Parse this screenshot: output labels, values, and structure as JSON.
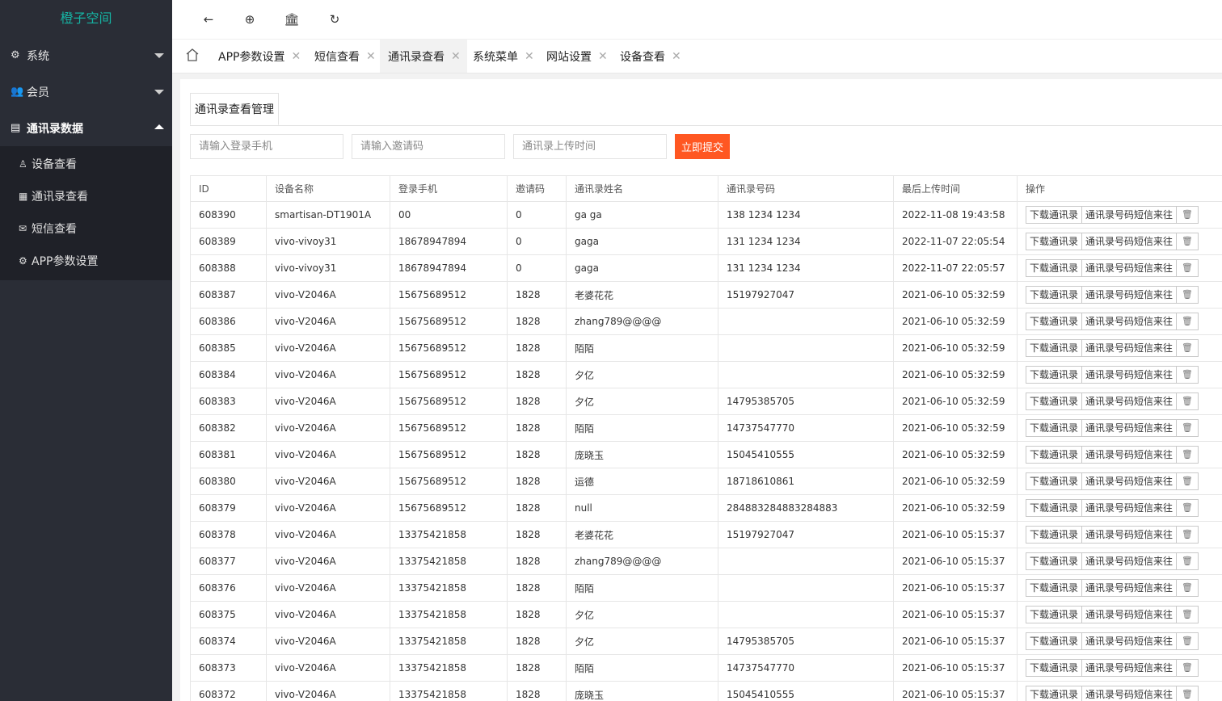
{
  "sidebar": {
    "logo": "橙子空间",
    "groups": [
      {
        "icon": "gear-icon",
        "label": "系统",
        "expanded": false
      },
      {
        "icon": "users-icon",
        "label": "会员",
        "expanded": false
      },
      {
        "icon": "card-icon",
        "label": "通讯录数据",
        "expanded": true
      }
    ],
    "items": [
      {
        "icon": "user-icon",
        "label": "设备查看"
      },
      {
        "icon": "building-icon",
        "label": "通讯录查看"
      },
      {
        "icon": "envelope-icon",
        "label": "短信查看"
      },
      {
        "icon": "gear-icon",
        "label": "APP参数设置"
      }
    ]
  },
  "toolbar": {
    "back_icon": "←",
    "globe_icon": "⊕",
    "bank_icon": "🏛",
    "refresh_icon": "↻"
  },
  "tabs": [
    {
      "label": "APP参数设置"
    },
    {
      "label": "短信查看"
    },
    {
      "label": "通讯录查看",
      "active": true
    },
    {
      "label": "系统菜单"
    },
    {
      "label": "网站设置"
    },
    {
      "label": "设备查看"
    }
  ],
  "tab_close": "✕",
  "panel": {
    "title": "通讯录查看管理"
  },
  "search": {
    "phone_placeholder": "请输入登录手机",
    "invite_placeholder": "请输入邀请码",
    "time_placeholder": "通讯录上传时间",
    "submit": "立即提交"
  },
  "table": {
    "headers": [
      "ID",
      "设备名称",
      "登录手机",
      "邀请码",
      "通讯录姓名",
      "通讯录号码",
      "最后上传时间",
      "操作"
    ],
    "actions": [
      "下载通讯录",
      "通讯录号码短信来往",
      "🗑"
    ],
    "rows": [
      [
        "608390",
        "smartisan-DT1901A",
        "00",
        "0",
        "ga ga",
        "138 1234 1234",
        "2022-11-08 19:43:58"
      ],
      [
        "608389",
        "vivo-vivoy31",
        "18678947894",
        "0",
        "gaga",
        "131 1234 1234",
        "2022-11-07 22:05:54"
      ],
      [
        "608388",
        "vivo-vivoy31",
        "18678947894",
        "0",
        "gaga",
        "131 1234 1234",
        "2022-11-07 22:05:57"
      ],
      [
        "608387",
        "vivo-V2046A",
        "15675689512",
        "1828",
        "老婆花花",
        "15197927047",
        "2021-06-10 05:32:59"
      ],
      [
        "608386",
        "vivo-V2046A",
        "15675689512",
        "1828",
        "zhang789@@@@",
        "",
        "2021-06-10 05:32:59"
      ],
      [
        "608385",
        "vivo-V2046A",
        "15675689512",
        "1828",
        "陌陌",
        "",
        "2021-06-10 05:32:59"
      ],
      [
        "608384",
        "vivo-V2046A",
        "15675689512",
        "1828",
        "夕亿",
        "",
        "2021-06-10 05:32:59"
      ],
      [
        "608383",
        "vivo-V2046A",
        "15675689512",
        "1828",
        "夕亿",
        "14795385705",
        "2021-06-10 05:32:59"
      ],
      [
        "608382",
        "vivo-V2046A",
        "15675689512",
        "1828",
        "陌陌",
        "14737547770",
        "2021-06-10 05:32:59"
      ],
      [
        "608381",
        "vivo-V2046A",
        "15675689512",
        "1828",
        "庞晓玉",
        "15045410555",
        "2021-06-10 05:32:59"
      ],
      [
        "608380",
        "vivo-V2046A",
        "15675689512",
        "1828",
        "运德",
        "18718610861",
        "2021-06-10 05:32:59"
      ],
      [
        "608379",
        "vivo-V2046A",
        "15675689512",
        "1828",
        "null",
        "284883284883284883",
        "2021-06-10 05:32:59"
      ],
      [
        "608378",
        "vivo-V2046A",
        "13375421858",
        "1828",
        "老婆花花",
        "15197927047",
        "2021-06-10 05:15:37"
      ],
      [
        "608377",
        "vivo-V2046A",
        "13375421858",
        "1828",
        "zhang789@@@@",
        "",
        "2021-06-10 05:15:37"
      ],
      [
        "608376",
        "vivo-V2046A",
        "13375421858",
        "1828",
        "陌陌",
        "",
        "2021-06-10 05:15:37"
      ],
      [
        "608375",
        "vivo-V2046A",
        "13375421858",
        "1828",
        "夕亿",
        "",
        "2021-06-10 05:15:37"
      ],
      [
        "608374",
        "vivo-V2046A",
        "13375421858",
        "1828",
        "夕亿",
        "14795385705",
        "2021-06-10 05:15:37"
      ],
      [
        "608373",
        "vivo-V2046A",
        "13375421858",
        "1828",
        "陌陌",
        "14737547770",
        "2021-06-10 05:15:37"
      ],
      [
        "608372",
        "vivo-V2046A",
        "13375421858",
        "1828",
        "庞晓玉",
        "15045410555",
        "2021-06-10 05:15:37"
      ]
    ]
  },
  "colors": {
    "sidebar_bg": "#2a2d36",
    "logo": "#16b3a3",
    "submit": "#ff5722"
  }
}
